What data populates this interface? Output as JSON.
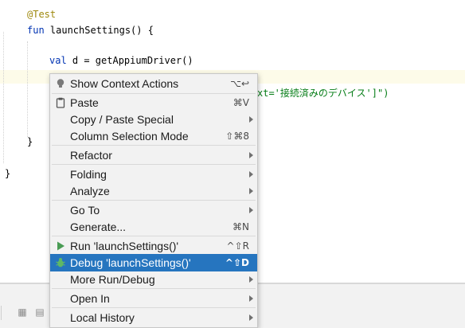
{
  "editor": {
    "lines": {
      "annotation": "@Test",
      "fun_keyword": "fun",
      "fun_sig": " launchSettings() {",
      "val_keyword": "val",
      "val_rest": " d = getAppiumDriver()",
      "partial_string": "xt='接続済みのデバイス']\")",
      "inner_brace": "}",
      "outer_brace": "}"
    }
  },
  "context_menu": {
    "items": [
      {
        "label": "Show Context Actions",
        "shortcut": "⌥↩",
        "icon": "lightbulb-icon"
      },
      {
        "label": "Paste",
        "shortcut": "⌘V",
        "icon": "clipboard-icon"
      },
      {
        "label": "Copy / Paste Special",
        "submenu": true
      },
      {
        "label": "Column Selection Mode",
        "shortcut": "⇧⌘8"
      },
      {
        "label": "Refactor",
        "submenu": true
      },
      {
        "label": "Folding",
        "submenu": true
      },
      {
        "label": "Analyze",
        "submenu": true
      },
      {
        "label": "Go To",
        "submenu": true
      },
      {
        "label": "Generate...",
        "shortcut": "⌘N"
      },
      {
        "label": "Run 'launchSettings()'",
        "shortcut": "^⇧R",
        "icon": "run-icon"
      },
      {
        "label": "Debug 'launchSettings()'",
        "shortcut": "^⇧D",
        "icon": "debug-icon",
        "selected": true
      },
      {
        "label": "More Run/Debug",
        "submenu": true
      },
      {
        "label": "Open In",
        "submenu": true
      },
      {
        "label": "Local History",
        "submenu": true
      }
    ]
  },
  "colors": {
    "selection": "#2675bf",
    "run_green": "#499c54",
    "annotation": "#9e880d",
    "keyword": "#0033b3",
    "string": "#067d17"
  }
}
